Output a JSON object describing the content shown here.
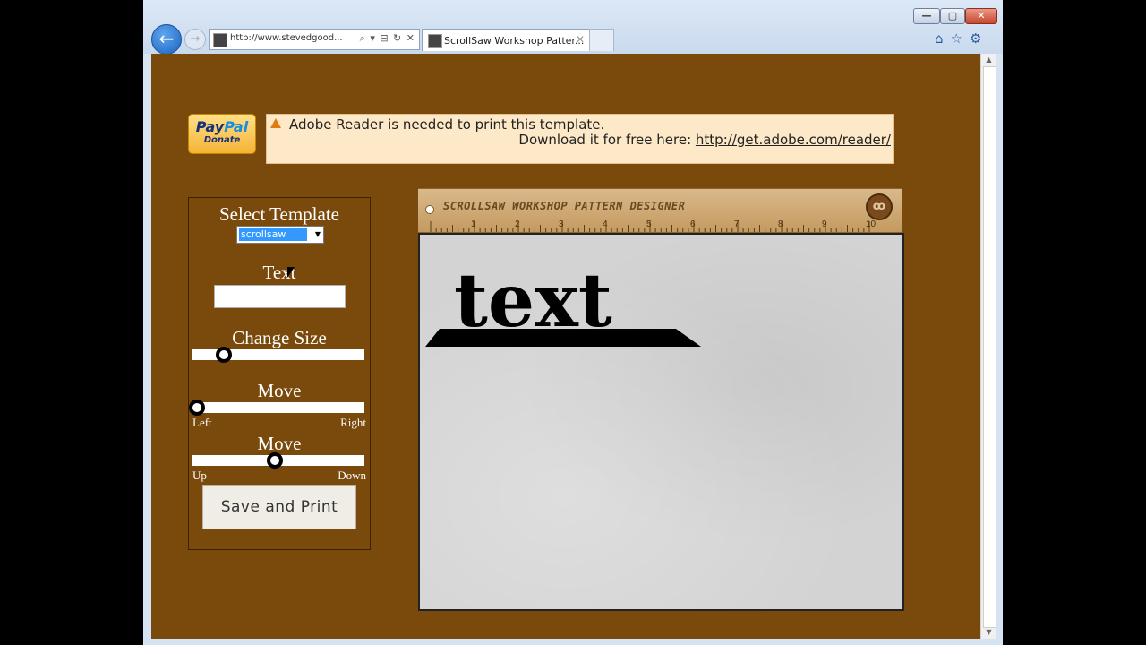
{
  "browser": {
    "address_url": "http://www.stevedgood...",
    "tab_title": "ScrollSaw Workshop Patter...",
    "window_controls": {
      "minimize": "—",
      "maximize": "▢",
      "close": "✕"
    },
    "address_tools": "⌕ ▾ ⊟ ↻ ✕",
    "right_icons": "⌂☆⚙"
  },
  "page": {
    "paypal": {
      "brand_pay": "Pay",
      "brand_pal": "Pal",
      "donate": "Donate"
    },
    "notice": {
      "line1": "Adobe Reader is needed to print this template.",
      "line2_prefix": "Download it for free here: ",
      "link": "http://get.adobe.com/reader/"
    },
    "panel": {
      "select_template_label": "Select Template",
      "template_value": "scrollsaw",
      "text_label": "Text",
      "text_value": "",
      "change_size_label": "Change Size",
      "move_horizontal_label": "Move",
      "left_label": "Left",
      "right_label": "Right",
      "move_vertical_label": "Move",
      "up_label": "Up",
      "down_label": "Down",
      "save_button": "Save and Print",
      "size_slider_value": 0.17,
      "horizontal_slider_value": 0.0,
      "vertical_slider_value": 0.5
    },
    "designer": {
      "ruler_title": "SCROLLSAW WORKSHOP PATTERN DESIGNER",
      "ruler_numbers": [
        "1",
        "2",
        "3",
        "4",
        "5",
        "6",
        "7",
        "8",
        "9",
        "10"
      ],
      "logo": "ꝏ",
      "pattern_text": "text"
    }
  }
}
